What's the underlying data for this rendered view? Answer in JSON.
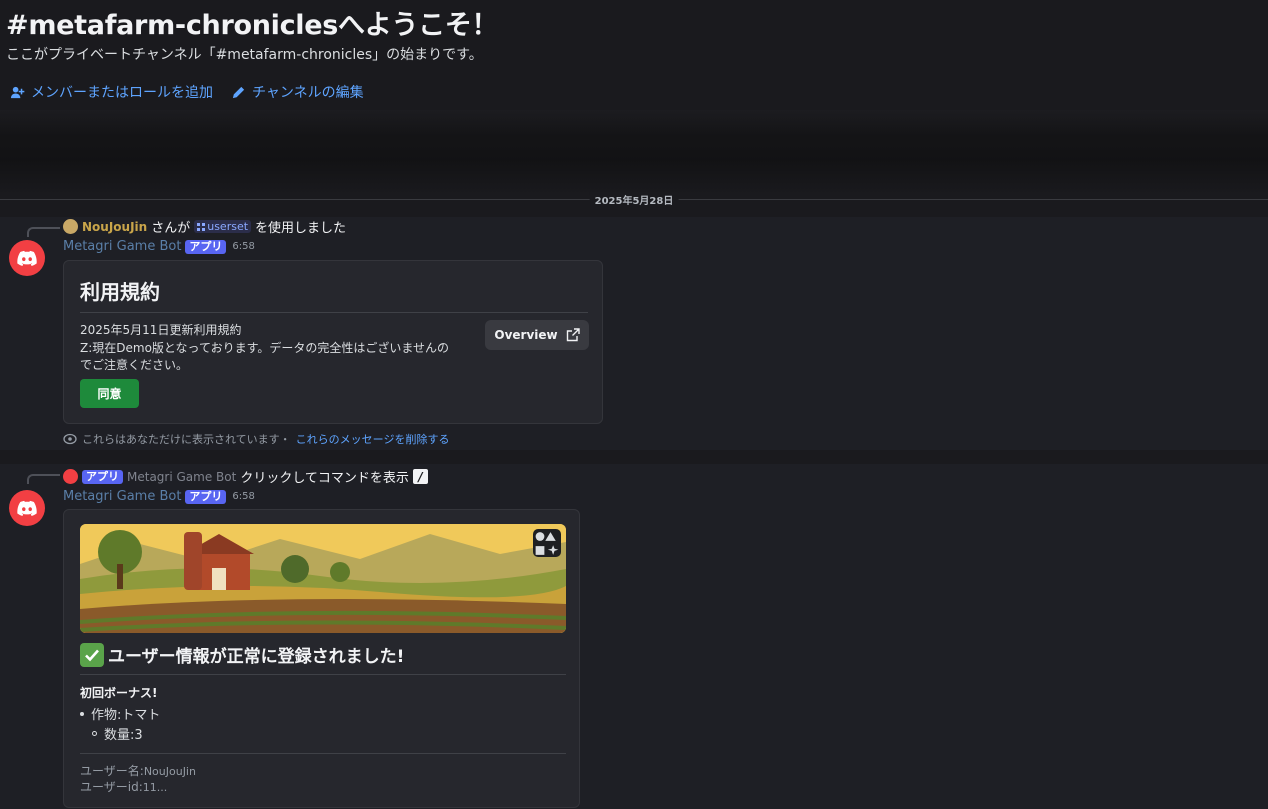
{
  "welcome": {
    "title": "#metafarm-chroniclesへようこそ！",
    "subtitle": "ここがプライベートチャンネル「#metafarm-chronicles」の始まりです。",
    "add_member_label": "メンバーまたはロールを追加",
    "edit_channel_label": "チャンネルの編集"
  },
  "date_divider": "2025年5月28日",
  "message1": {
    "reply_user": "NouJouJin",
    "reply_mid": "さんが",
    "reply_cmd": "userset",
    "reply_suffix": "を使用しました",
    "author": "Metagri Game Bot",
    "app_tag": "アプリ",
    "time": "6:58",
    "card": {
      "title": "利用規約",
      "line1": "2025年5月11日更新利用規約",
      "line2": "Z:現在Demo版となっております。データの完全性はございませんの",
      "line3": "でご注意ください。",
      "overview_label": "Overview",
      "agree_label": "同意"
    },
    "ephemeral_text": "これらはあなただけに表示されています・",
    "ephemeral_link": "これらのメッセージを削除する"
  },
  "message2": {
    "reply_app_tag": "アプリ",
    "reply_bot": "Metagri Game Bot",
    "reply_text": "クリックしてコマンドを表示",
    "author": "Metagri Game Bot",
    "app_tag": "アプリ",
    "time": "6:58",
    "card": {
      "success_title": "ユーザー情報が正常に登録されました!",
      "bonus_label": "初回ボーナス!",
      "item_crop": "作物:トマト",
      "item_qty": "数量:3",
      "username_label": "ユーザー名:",
      "username_value": "NouJouJin",
      "userid_label": "ユーザーid:",
      "userid_value": "11..."
    }
  },
  "colors": {
    "accent_link": "#5ea4ff",
    "app_tag": "#5865f2",
    "agree_button": "#1e8a3b",
    "bot_avatar": "#f23f43"
  }
}
